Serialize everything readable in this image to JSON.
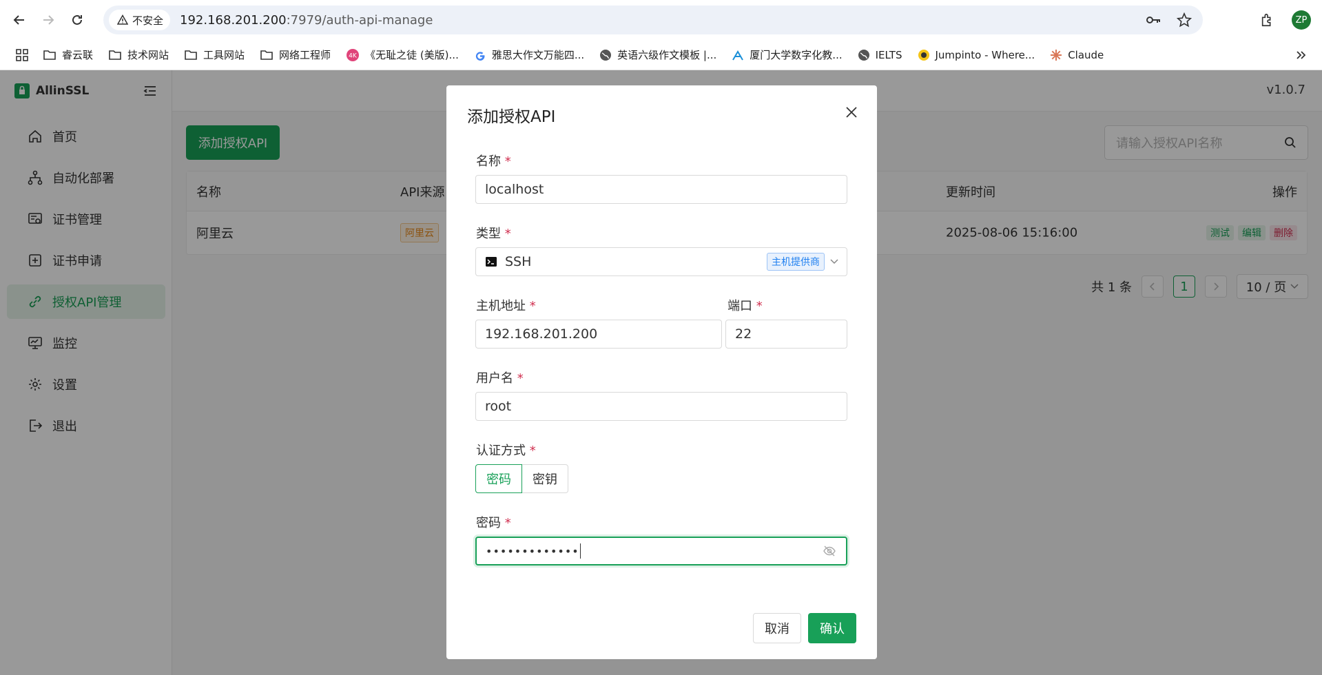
{
  "browser": {
    "security_label": "不安全",
    "url_host": "192.168.201.200",
    "url_rest": ":7979/auth-api-manage",
    "profile_initials": "ZP",
    "bookmarks": [
      {
        "label": "睿云联",
        "icon": "folder-icon"
      },
      {
        "label": "技术网站",
        "icon": "folder-icon"
      },
      {
        "label": "工具网站",
        "icon": "folder-icon"
      },
      {
        "label": "网络工程师",
        "icon": "folder-icon"
      },
      {
        "label": "《无耻之徒 (美版)...",
        "icon": "4k-icon"
      },
      {
        "label": "雅思大作文万能四...",
        "icon": "google-icon"
      },
      {
        "label": "英语六级作文模板 |...",
        "icon": "globe-icon"
      },
      {
        "label": "厦门大学数字化教...",
        "icon": "xmu-icon"
      },
      {
        "label": "IELTS",
        "icon": "globe-icon"
      },
      {
        "label": "Jumpinto - Where...",
        "icon": "jumpinto-icon"
      },
      {
        "label": "Claude",
        "icon": "claude-icon"
      }
    ]
  },
  "app": {
    "brand": "AllinSSL",
    "version": "v1.0.7",
    "menu": [
      {
        "label": "首页",
        "icon": "home-icon"
      },
      {
        "label": "自动化部署",
        "icon": "workflow-icon"
      },
      {
        "label": "证书管理",
        "icon": "certificate-icon"
      },
      {
        "label": "证书申请",
        "icon": "plus-square-icon"
      },
      {
        "label": "授权API管理",
        "icon": "link-icon"
      },
      {
        "label": "监控",
        "icon": "monitor-icon"
      },
      {
        "label": "设置",
        "icon": "gear-icon"
      },
      {
        "label": "退出",
        "icon": "logout-icon"
      }
    ],
    "add_button": "添加授权API",
    "search_placeholder": "请输入授权API名称",
    "table": {
      "headers": {
        "name": "名称",
        "source": "API来源",
        "updated": "更新时间",
        "actions": "操作"
      },
      "rows": [
        {
          "name": "阿里云",
          "source": "阿里云",
          "updated": "2025-08-06 15:16:00",
          "test": "测试",
          "edit": "编辑",
          "delete": "删除"
        }
      ]
    },
    "pagination": {
      "total": "共 1 条",
      "current": "1",
      "page_size": "10 / 页"
    }
  },
  "modal": {
    "title": "添加授权API",
    "fields": {
      "name": {
        "label": "名称",
        "required": "*",
        "value": "localhost"
      },
      "type": {
        "label": "类型",
        "required": "*",
        "value": "SSH",
        "tag": "主机提供商"
      },
      "host": {
        "label": "主机地址",
        "required": "*",
        "value": "192.168.201.200"
      },
      "port": {
        "label": "端口",
        "required": "*",
        "value": "22"
      },
      "username": {
        "label": "用户名",
        "required": "*",
        "value": "root"
      },
      "auth": {
        "label": "认证方式",
        "required": "*",
        "options": [
          "密码",
          "密钥"
        ],
        "selected": "密码"
      },
      "password": {
        "label": "密码",
        "required": "*",
        "value": "•••••••••••••"
      }
    },
    "cancel": "取消",
    "confirm": "确认"
  },
  "colors": {
    "primary": "#18a058",
    "danger": "#d03050",
    "info": "#2080f0"
  }
}
